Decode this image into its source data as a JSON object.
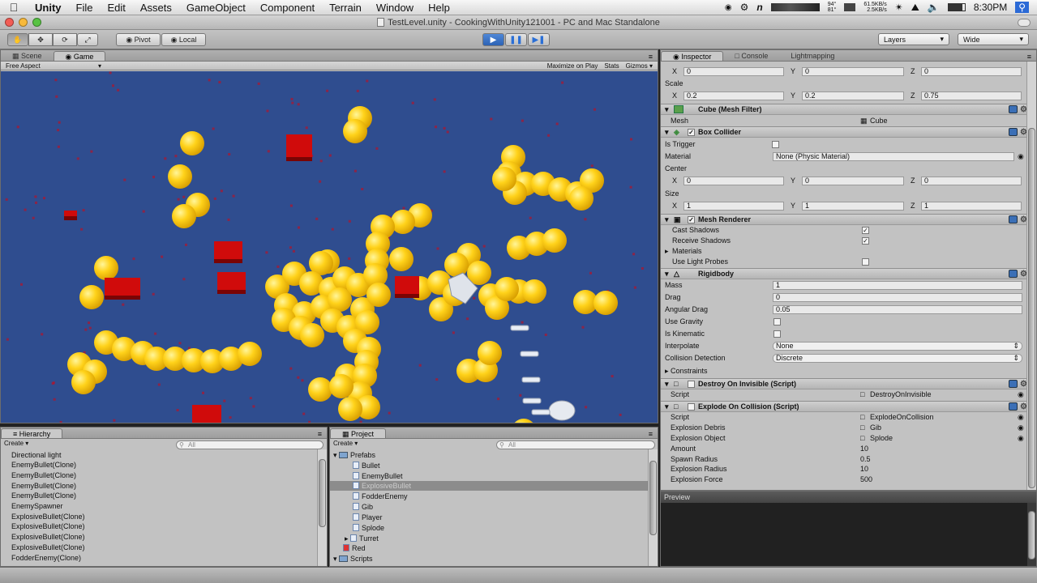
{
  "menubar": {
    "app": "Unity",
    "items": [
      "File",
      "Edit",
      "Assets",
      "GameObject",
      "Component",
      "Terrain",
      "Window",
      "Help"
    ],
    "temp1": "94°",
    "temp2": "81°",
    "net1": "61.5KB/s",
    "net2": "2.5KB/s",
    "time": "8:30PM",
    "n_icon": "n"
  },
  "window": {
    "title": "TestLevel.unity - CookingWithUnity121001 - PC and Mac Standalone"
  },
  "toolbar": {
    "pivot": "Pivot",
    "local": "Local",
    "layers": "Layers",
    "layout": "Wide"
  },
  "scene_tabs": {
    "scene": "Scene",
    "game": "Game"
  },
  "game_bar": {
    "aspect": "Free Aspect",
    "maximize": "Maximize on Play",
    "stats": "Stats",
    "gizmos": "Gizmos"
  },
  "inspector": {
    "tabs": [
      "Inspector",
      "Console",
      "Lightmapping"
    ],
    "top_row": {
      "x": "0",
      "y": "0",
      "z": "0"
    },
    "scale_label": "Scale",
    "scale": {
      "x": "0.2",
      "y": "0.2",
      "z": "0.75"
    },
    "mesh_filter": {
      "title": "Cube (Mesh Filter)",
      "mesh_label": "Mesh",
      "mesh_value": "Cube"
    },
    "box_collider": {
      "title": "Box Collider",
      "is_trigger": "Is Trigger",
      "material": "Material",
      "material_value": "None (Physic Material)",
      "center": "Center",
      "center_vals": {
        "x": "0",
        "y": "0",
        "z": "0"
      },
      "size": "Size",
      "size_vals": {
        "x": "1",
        "y": "1",
        "z": "1"
      }
    },
    "mesh_renderer": {
      "title": "Mesh Renderer",
      "cast": "Cast Shadows",
      "receive": "Receive Shadows",
      "materials": "Materials",
      "probes": "Use Light Probes"
    },
    "rigidbody": {
      "title": "Rigidbody",
      "mass": "Mass",
      "mass_v": "1",
      "drag": "Drag",
      "drag_v": "0",
      "angular": "Angular Drag",
      "angular_v": "0.05",
      "gravity": "Use Gravity",
      "kinematic": "Is Kinematic",
      "interpolate": "Interpolate",
      "interpolate_v": "None",
      "collision": "Collision Detection",
      "collision_v": "Discrete",
      "constraints": "Constraints"
    },
    "destroy": {
      "title": "Destroy On Invisible (Script)",
      "script": "Script",
      "script_v": "DestroyOnInvisible"
    },
    "explode": {
      "title": "Explode On Collision (Script)",
      "script": "Script",
      "script_v": "ExplodeOnCollision",
      "debris": "Explosion Debris",
      "debris_v": "Gib",
      "object": "Explosion Object",
      "object_v": "Splode",
      "amount": "Amount",
      "amount_v": "10",
      "spawn": "Spawn Radius",
      "spawn_v": "0.5",
      "radius": "Explosion Radius",
      "radius_v": "10",
      "force": "Explosion Force",
      "force_v": "500"
    },
    "axis": {
      "x": "X",
      "y": "Y",
      "z": "Z"
    }
  },
  "preview": {
    "title": "Preview"
  },
  "hierarchy": {
    "tab": "Hierarchy",
    "create": "Create",
    "search_placeholder": "All",
    "items": [
      "Directional light",
      "EnemyBullet(Clone)",
      "EnemyBullet(Clone)",
      "EnemyBullet(Clone)",
      "EnemyBullet(Clone)",
      "EnemySpawner",
      "ExplosiveBullet(Clone)",
      "ExplosiveBullet(Clone)",
      "ExplosiveBullet(Clone)",
      "ExplosiveBullet(Clone)",
      "FodderEnemy(Clone)"
    ]
  },
  "project": {
    "tab": "Project",
    "create": "Create",
    "search_placeholder": "All",
    "items": [
      {
        "label": "Prefabs",
        "type": "folder",
        "indent": 0
      },
      {
        "label": "Bullet",
        "type": "file",
        "indent": 1
      },
      {
        "label": "EnemyBullet",
        "type": "file",
        "indent": 1
      },
      {
        "label": "ExplosiveBullet",
        "type": "file",
        "indent": 1,
        "selected": true
      },
      {
        "label": "FodderEnemy",
        "type": "file",
        "indent": 1
      },
      {
        "label": "Gib",
        "type": "file",
        "indent": 1
      },
      {
        "label": "Player",
        "type": "file",
        "indent": 1
      },
      {
        "label": "Splode",
        "type": "file",
        "indent": 1
      },
      {
        "label": "Turret",
        "type": "file",
        "indent": 1
      },
      {
        "label": "Red",
        "type": "file",
        "indent": 0
      },
      {
        "label": "Scripts",
        "type": "folder",
        "indent": 0
      }
    ]
  },
  "colors": {
    "game_bg": "#2f4d8f",
    "sphere": "#ffd21a",
    "cube": "#d00b0b",
    "play_active": "#2c62b4"
  }
}
